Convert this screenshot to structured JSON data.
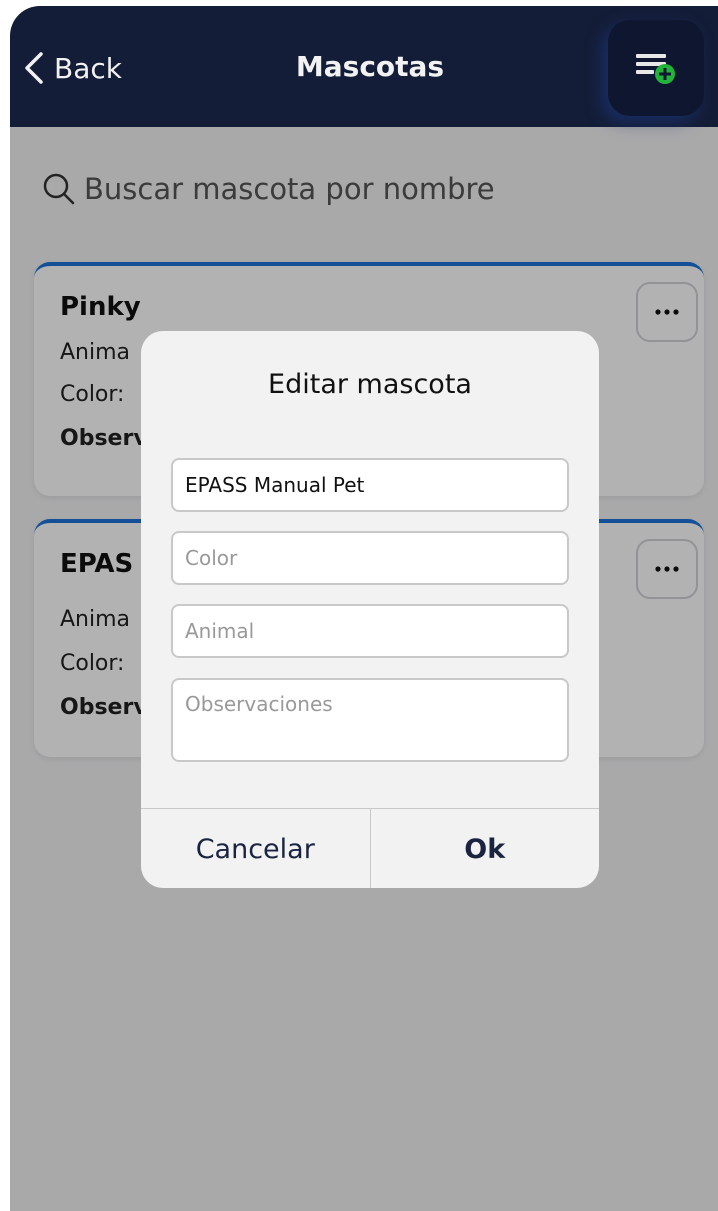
{
  "header": {
    "back_label": "Back",
    "title": "Mascotas",
    "add_icon": "list-add-icon"
  },
  "search": {
    "placeholder": "Buscar mascota por nombre",
    "icon": "search-icon"
  },
  "pets": [
    {
      "name": "Pinky",
      "animal_label": "Anima",
      "color_label": "Color:",
      "obs_label": "Observ"
    },
    {
      "name": "EPAS",
      "animal_label": "Anima",
      "color_label": "Color:",
      "obs_label": "Observ"
    }
  ],
  "dialog": {
    "title": "Editar mascota",
    "name_value": "EPASS Manual Pet",
    "color_placeholder": "Color",
    "animal_placeholder": "Animal",
    "observations_placeholder": "Observaciones",
    "cancel_label": "Cancelar",
    "ok_label": "Ok"
  },
  "colors": {
    "header_bg": "#141d37",
    "card_accent": "#1e73d8",
    "add_badge": "#22b33a"
  }
}
